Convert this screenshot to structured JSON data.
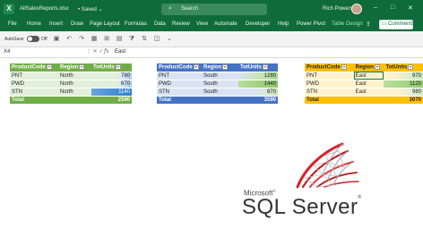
{
  "titlebar": {
    "app_icon": "excel-logo-icon",
    "app_letter": "X",
    "filename": "AllSalesReports.xlsx",
    "saved": "• Saved ⌄",
    "search_placeholder": "Search",
    "user": "Rich Powers",
    "minimize": "–",
    "maximize": "□",
    "close": "✕"
  },
  "menu": {
    "items": [
      "File",
      "Home",
      "Insert",
      "Draw",
      "Page Layout",
      "Formulas",
      "Data",
      "Review",
      "View",
      "Automate",
      "Developer",
      "Help",
      "Power Pivot",
      "Table Design"
    ],
    "active": "Table Design",
    "comments": "Comments"
  },
  "qat": {
    "autosave": "AutoSave",
    "autosave_state": "Off"
  },
  "formula_bar": {
    "name_box": "X4",
    "fx": "fx",
    "value": "East"
  },
  "tables": [
    {
      "color": "#70ad47",
      "headers": [
        "ProductCode",
        "Region",
        "TotUnits"
      ],
      "rows": [
        {
          "code": "PNT",
          "region": "North",
          "units": "780"
        },
        {
          "code": "PWD",
          "region": "North",
          "units": "670"
        },
        {
          "code": "STN",
          "region": "North",
          "units": "1140"
        }
      ],
      "total_label": "Total",
      "total_value": "2590"
    },
    {
      "color": "#4472c4",
      "headers": [
        "ProductCode",
        "Region",
        "TotUnits"
      ],
      "rows": [
        {
          "code": "PNT",
          "region": "South",
          "units": "1280"
        },
        {
          "code": "PWD",
          "region": "South",
          "units": "1440"
        },
        {
          "code": "STN",
          "region": "South",
          "units": "870"
        }
      ],
      "total_label": "Total",
      "total_value": "3590"
    },
    {
      "color": "#ffc000",
      "headers": [
        "ProductCode",
        "Region",
        "TotUnits"
      ],
      "rows": [
        {
          "code": "PNT",
          "region": "East",
          "units": "970"
        },
        {
          "code": "PWD",
          "region": "East",
          "units": "1120"
        },
        {
          "code": "STN",
          "region": "East",
          "units": "980"
        }
      ],
      "total_label": "Total",
      "total_value": "3070"
    }
  ],
  "logo": {
    "icon": "sql-server-logo-icon",
    "brand": "Microsoft",
    "product": "SQL Server"
  }
}
